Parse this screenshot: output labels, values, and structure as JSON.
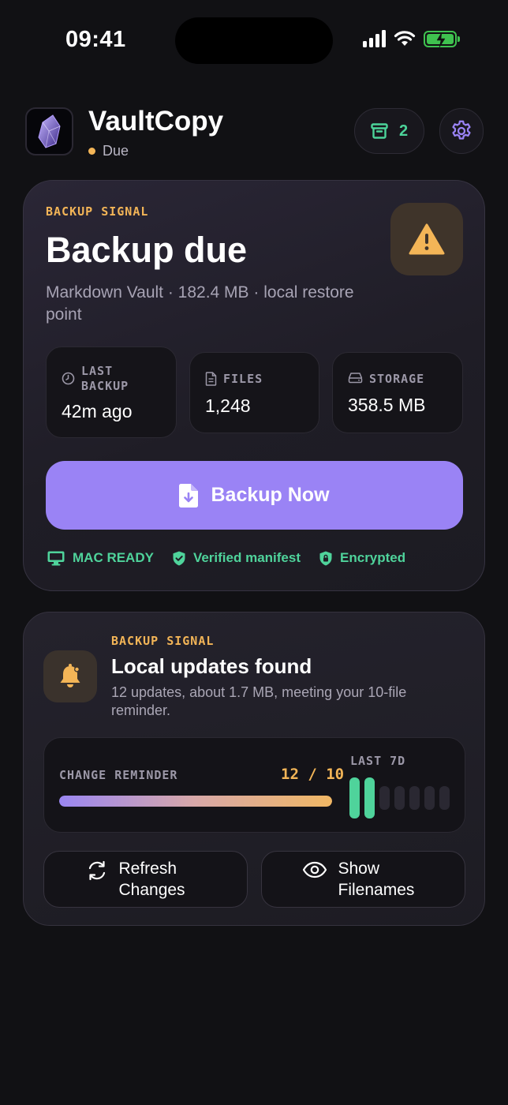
{
  "status_bar": {
    "time": "09:41"
  },
  "header": {
    "app_name": "VaultCopy",
    "status_text": "Due",
    "archive_count": "2"
  },
  "backup_card": {
    "eyebrow": "BACKUP SIGNAL",
    "title": "Backup due",
    "subtitle": "Markdown Vault · 182.4 MB · local restore point",
    "stats": [
      {
        "label": "LAST BACKUP",
        "value": "42m ago",
        "icon": "clock-icon"
      },
      {
        "label": "FILES",
        "value": "1,248",
        "icon": "file-icon"
      },
      {
        "label": "STORAGE",
        "value": "358.5 MB",
        "icon": "drive-icon"
      }
    ],
    "backup_button_label": "Backup Now",
    "badges": [
      {
        "label": "MAC READY",
        "icon": "monitor-icon"
      },
      {
        "label": "Verified manifest",
        "icon": "shield-check-icon"
      },
      {
        "label": "Encrypted",
        "icon": "lock-shield-icon"
      }
    ]
  },
  "updates_card": {
    "eyebrow": "BACKUP SIGNAL",
    "title": "Local updates found",
    "subtitle": "12 updates, about 1.7 MB, meeting your 10-file reminder.",
    "reminder": {
      "label": "CHANGE REMINDER",
      "count_text": "12 / 10",
      "progress": 1.0
    },
    "last7": {
      "label": "LAST 7D",
      "days_active": [
        true,
        true,
        false,
        false,
        false,
        false,
        false
      ]
    },
    "refresh_label": "Refresh Changes",
    "show_label": "Show Filenames"
  },
  "colors": {
    "accent_purple": "#9a83f5",
    "warning_amber": "#f3b557",
    "success_green": "#4fd39b",
    "background": "#111114"
  }
}
